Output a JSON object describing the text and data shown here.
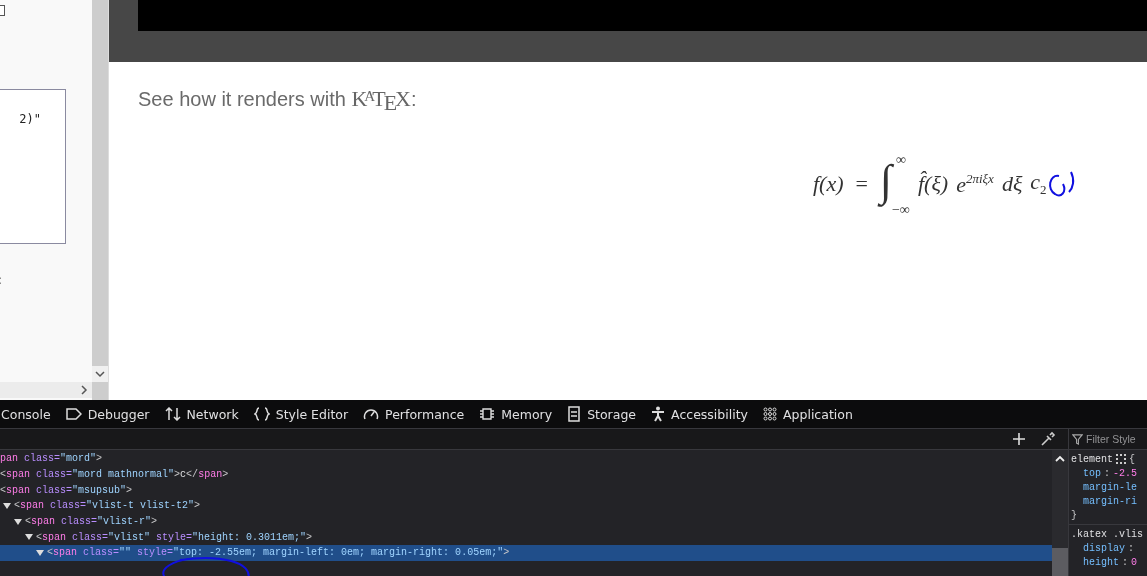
{
  "sidebar": {
    "checkbox": {
      "checked": false
    },
    "textarea": {
      "value": "2)\""
    },
    "cut_text": ":"
  },
  "page": {
    "intro": "See how it renders with ",
    "logo": "K$^{A}$T$_{E}$X",
    "suffix": ":",
    "formula": {
      "lhs": "f(x)",
      "equals": "=",
      "integral": "∫",
      "upper": "∞",
      "lower": "−∞",
      "integrand": "f̂(ξ)",
      "base": "e",
      "exponent": "2πiξx",
      "differential": "dξ",
      "tail": "c",
      "tail_sub": "2"
    }
  },
  "devtools": {
    "tabs": [
      {
        "kind": "console",
        "label": "Console"
      },
      {
        "kind": "debugger",
        "label": "Debugger"
      },
      {
        "kind": "network",
        "label": "Network"
      },
      {
        "kind": "style",
        "label": "Style Editor"
      },
      {
        "kind": "performance",
        "label": "Performance"
      },
      {
        "kind": "memory",
        "label": "Memory"
      },
      {
        "kind": "storage",
        "label": "Storage"
      },
      {
        "kind": "accessibility",
        "label": "Accessibility"
      },
      {
        "kind": "application",
        "label": "Application"
      }
    ],
    "markup": [
      {
        "selected": false,
        "parts": [
          {
            "kind": "tag",
            "text": "pan"
          },
          {
            "kind": "attr",
            "text": " class="
          },
          {
            "kind": "value",
            "text": "\"mord\""
          },
          {
            "kind": "punct",
            "text": ">"
          }
        ]
      },
      {
        "selected": false,
        "parts": [
          {
            "kind": "punct",
            "text": "<"
          },
          {
            "kind": "tag",
            "text": "span"
          },
          {
            "kind": "attr",
            "text": " class="
          },
          {
            "kind": "value",
            "text": "\"mord mathnormal\""
          },
          {
            "kind": "punct",
            "text": ">"
          },
          {
            "kind": "text",
            "text": "c"
          },
          {
            "kind": "punct",
            "text": "</"
          },
          {
            "kind": "tag",
            "text": "span"
          },
          {
            "kind": "punct",
            "text": ">"
          }
        ]
      },
      {
        "selected": false,
        "parts": [
          {
            "kind": "punct",
            "text": "<"
          },
          {
            "kind": "tag",
            "text": "span"
          },
          {
            "kind": "attr",
            "text": " class="
          },
          {
            "kind": "value",
            "text": "\"msupsub\""
          },
          {
            "kind": "punct",
            "text": ">"
          }
        ]
      },
      {
        "selected": false,
        "expanded": true,
        "parts": [
          {
            "kind": "punct",
            "text": "<"
          },
          {
            "kind": "tag",
            "text": "span"
          },
          {
            "kind": "attr",
            "text": " class="
          },
          {
            "kind": "value",
            "text": "\"vlist-t vlist-t2\""
          },
          {
            "kind": "punct",
            "text": ">"
          }
        ],
        "children": [
          {
            "selected": false,
            "expanded": true,
            "parts": [
              {
                "kind": "punct",
                "text": "<"
              },
              {
                "kind": "tag",
                "text": "span"
              },
              {
                "kind": "attr",
                "text": " class="
              },
              {
                "kind": "value",
                "text": "\"vlist-r\""
              },
              {
                "kind": "punct",
                "text": ">"
              }
            ],
            "children": [
              {
                "selected": false,
                "expanded": true,
                "parts": [
                  {
                    "kind": "punct",
                    "text": "<"
                  },
                  {
                    "kind": "tag",
                    "text": "span"
                  },
                  {
                    "kind": "attr",
                    "text": " class="
                  },
                  {
                    "kind": "value",
                    "text": "\"vlist\""
                  },
                  {
                    "kind": "attr",
                    "text": " style="
                  },
                  {
                    "kind": "value",
                    "text": "\"height: 0.3011em;\""
                  },
                  {
                    "kind": "punct",
                    "text": ">"
                  }
                ],
                "children": [
                  {
                    "selected": true,
                    "expanded": true,
                    "parts": [
                      {
                        "kind": "punct",
                        "text": "<"
                      },
                      {
                        "kind": "tag",
                        "text": "span"
                      },
                      {
                        "kind": "attr",
                        "text": " class="
                      },
                      {
                        "kind": "value",
                        "text": "\"\""
                      },
                      {
                        "kind": "attr",
                        "text": " style="
                      },
                      {
                        "kind": "value",
                        "text": "\"top: -2.55em; margin-left: 0em; margin-right: 0.05em;\""
                      },
                      {
                        "kind": "punct",
                        "text": ">"
                      }
                    ]
                  }
                ]
              }
            ]
          }
        ]
      }
    ],
    "filter": {
      "placeholder": "Filter Style"
    },
    "rules": [
      {
        "parts": [
          {
            "kind": "selector",
            "text": "element"
          },
          {
            "kind": "grid"
          },
          {
            "kind": "punct",
            "text": "{"
          }
        ]
      },
      {
        "parts": [
          {
            "kind": "prop",
            "text": "top"
          },
          {
            "kind": "punct",
            "text": ": "
          },
          {
            "kind": "value",
            "text": "-2.5"
          }
        ]
      },
      {
        "parts": [
          {
            "kind": "prop",
            "text": "margin-le"
          }
        ]
      },
      {
        "parts": [
          {
            "kind": "prop",
            "text": "margin-ri"
          }
        ]
      },
      {
        "parts": [
          {
            "kind": "punct",
            "text": "}"
          }
        ]
      },
      {
        "parts": [
          {
            "kind": "selector",
            "text": ".katex .vlis"
          }
        ]
      },
      {
        "parts": [
          {
            "kind": "prop",
            "text": "display"
          },
          {
            "kind": "punct",
            "text": ":"
          }
        ]
      },
      {
        "parts": [
          {
            "kind": "prop",
            "text": "height"
          },
          {
            "kind": "punct",
            "text": ": "
          },
          {
            "kind": "value",
            "text": "0"
          }
        ]
      }
    ]
  }
}
